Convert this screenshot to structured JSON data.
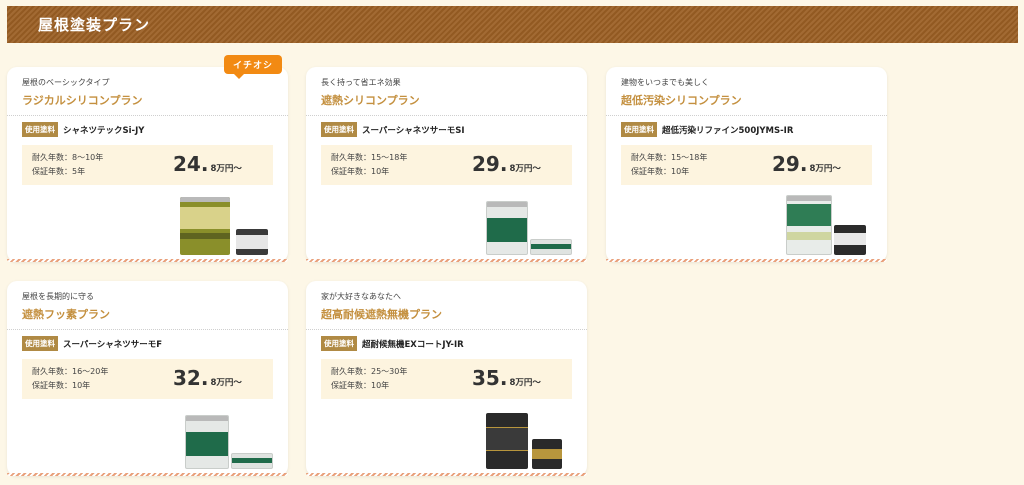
{
  "header": {
    "title": "屋根塗装プラン"
  },
  "plans": [
    {
      "badge": "イチオシ",
      "subtitle": "屋根のベーシックタイプ",
      "name": "ラジカルシリコンプラン",
      "paint_tag": "使用塗料",
      "paint_name": "シャネツテックSi-JY",
      "durability": "耐久年数：8～10年",
      "warranty": "保証年数：5年",
      "price": "24.",
      "price_unit": "8万円～",
      "product_colors": {
        "main": "#8a8f2a",
        "label": "#d9d28a",
        "small": "#3a3a3a"
      }
    },
    {
      "subtitle": "長く持って省エネ効果",
      "name": "遮熱シリコンプラン",
      "paint_tag": "使用塗料",
      "paint_name": "スーパーシャネツサーモSI",
      "durability": "耐久年数：15～18年",
      "warranty": "保証年数：10年",
      "price": "29.",
      "price_unit": "8万円～",
      "product_colors": {
        "main": "#e5e8e6",
        "label": "#1f6b4a",
        "small": "#dfe3e0"
      }
    },
    {
      "subtitle": "建物をいつまでも美しく",
      "name": "超低汚染シリコンプラン",
      "paint_tag": "使用塗料",
      "paint_name": "超低汚染リファイン500JYMS-IR",
      "durability": "耐久年数：15～18年",
      "warranty": "保証年数：10年",
      "price": "29.",
      "price_unit": "8万円～",
      "product_colors": {
        "main": "#e8ece9",
        "label": "#2f7d55",
        "small": "#2b2b2b"
      }
    },
    {
      "subtitle": "屋根を長期的に守る",
      "name": "遮熱フッ素プラン",
      "paint_tag": "使用塗料",
      "paint_name": "スーパーシャネツサーモF",
      "durability": "耐久年数：16～20年",
      "warranty": "保証年数：10年",
      "price": "32.",
      "price_unit": "8万円～",
      "product_colors": {
        "main": "#e5e8e6",
        "label": "#1f6b4a",
        "small": "#dfe3e0"
      }
    },
    {
      "subtitle": "家が大好きなあなたへ",
      "name": "超高耐候遮熱無機プラン",
      "paint_tag": "使用塗料",
      "paint_name": "超耐候無機EXコートJY-IR",
      "durability": "耐久年数：25～30年",
      "warranty": "保証年数：10年",
      "price": "35.",
      "price_unit": "8万円～",
      "product_colors": {
        "main": "#2a2a2a",
        "label": "#b8963d",
        "small": "#2a2a2a"
      }
    }
  ]
}
